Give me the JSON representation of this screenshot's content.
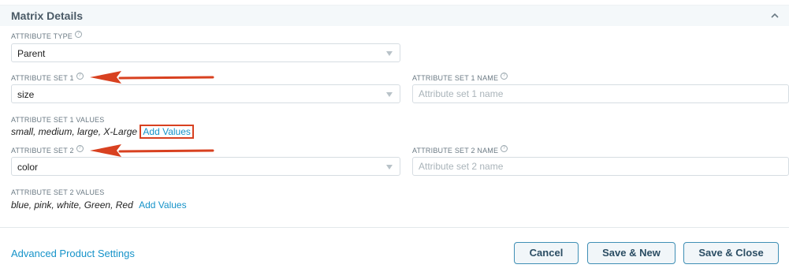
{
  "section": {
    "title": "Matrix Details",
    "collapse_icon": "chevron-up-icon"
  },
  "attribute_type": {
    "label": "ATTRIBUTE TYPE",
    "value": "Parent"
  },
  "attribute_set_1": {
    "label": "ATTRIBUTE SET 1",
    "value": "size",
    "name_label": "ATTRIBUTE SET 1 NAME",
    "name_placeholder": "Attribute set 1 name",
    "values_label": "ATTRIBUTE SET 1 VALUES",
    "values": "small, medium, large, X-Large",
    "add_values": "Add Values"
  },
  "attribute_set_2": {
    "label": "ATTRIBUTE SET 2",
    "value": "color",
    "name_label": "ATTRIBUTE SET 2 NAME",
    "name_placeholder": "Attribute set 2 name",
    "values_label": "ATTRIBUTE SET 2 VALUES",
    "values": "blue, pink, white, Green, Red",
    "add_values": "Add Values"
  },
  "help_glyph": "?",
  "footer": {
    "advanced_link": "Advanced Product Settings",
    "cancel": "Cancel",
    "save_new": "Save & New",
    "save_close": "Save & Close"
  },
  "colors": {
    "accent": "#1693c9",
    "annotation": "#d84120",
    "button_border": "#3f8fb5"
  }
}
